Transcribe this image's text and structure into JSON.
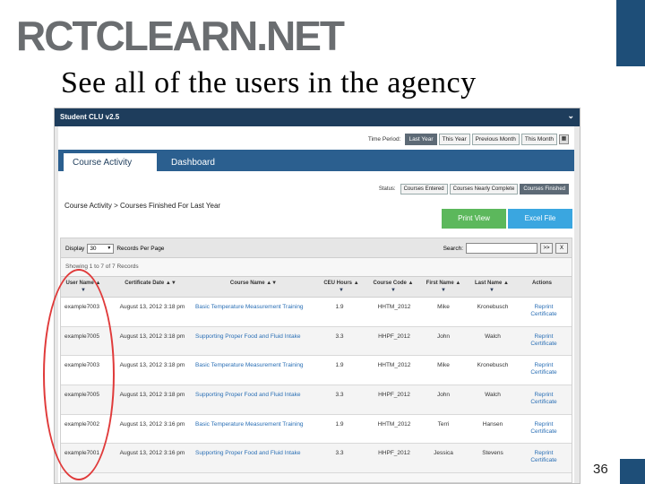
{
  "slide": {
    "logo": "RCTCLEARN.NET",
    "title": "See all of the users in the agency",
    "page_number": "36"
  },
  "app": {
    "window_title": "Student CLU v2.5",
    "time_period": {
      "label": "Time Period:",
      "options": [
        "Last Year",
        "This Year",
        "Previous Month",
        "This Month"
      ],
      "selected": "Last Year"
    },
    "tabs": [
      {
        "label": "Course Activity",
        "active": true
      },
      {
        "label": "Dashboard",
        "active": false
      }
    ],
    "status": {
      "label": "Status:",
      "options": [
        "Courses Entered",
        "Courses Nearly Complete",
        "Courses Finished"
      ],
      "selected": "Courses Finished"
    },
    "breadcrumb": "Course Activity   > Courses Finished For Last Year",
    "export": {
      "print_label": "Print View",
      "excel_label": "Excel File"
    },
    "grid": {
      "display_label": "Display",
      "display_value": "30",
      "records_per_page": "Records Per Page",
      "search_label": "Search:",
      "search_go": ">>",
      "search_clear": "X",
      "showing": "Showing 1 to 7 of 7 Records",
      "columns": [
        "User Name",
        "Certificate Date",
        "Course Name",
        "CEU Hours",
        "Course Code",
        "First Name",
        "Last Name",
        "Actions"
      ],
      "rows": [
        {
          "user": "example7003",
          "date": "August 13, 2012 3:18 pm",
          "course": "Basic Temperature Measurement Training",
          "ceu": "1.9",
          "code": "HHTM_2012",
          "first": "Mike",
          "last": "Kronebusch",
          "action": "Reprint Certificate"
        },
        {
          "user": "example7005",
          "date": "August 13, 2012 3:18 pm",
          "course": "Supporting Proper Food and Fluid Intake",
          "ceu": "3.3",
          "code": "HHPF_2012",
          "first": "John",
          "last": "Walch",
          "action": "Reprint Certificate"
        },
        {
          "user": "example7003",
          "date": "August 13, 2012 3:18 pm",
          "course": "Basic Temperature Measurement Training",
          "ceu": "1.9",
          "code": "HHTM_2012",
          "first": "Mike",
          "last": "Kronebusch",
          "action": "Reprint Certificate"
        },
        {
          "user": "example7005",
          "date": "August 13, 2012 3:18 pm",
          "course": "Supporting Proper Food and Fluid Intake",
          "ceu": "3.3",
          "code": "HHPF_2012",
          "first": "John",
          "last": "Walch",
          "action": "Reprint Certificate"
        },
        {
          "user": "example7002",
          "date": "August 13, 2012 3:16 pm",
          "course": "Basic Temperature Measurement Training",
          "ceu": "1.9",
          "code": "HHTM_2012",
          "first": "Terri",
          "last": "Hansen",
          "action": "Reprint Certificate"
        },
        {
          "user": "example7001",
          "date": "August 13, 2012 3:16 pm",
          "course": "Supporting Proper Food and Fluid Intake",
          "ceu": "3.3",
          "code": "HHPF_2012",
          "first": "Jessica",
          "last": "Stevens",
          "action": "Reprint Certificate"
        }
      ]
    }
  }
}
